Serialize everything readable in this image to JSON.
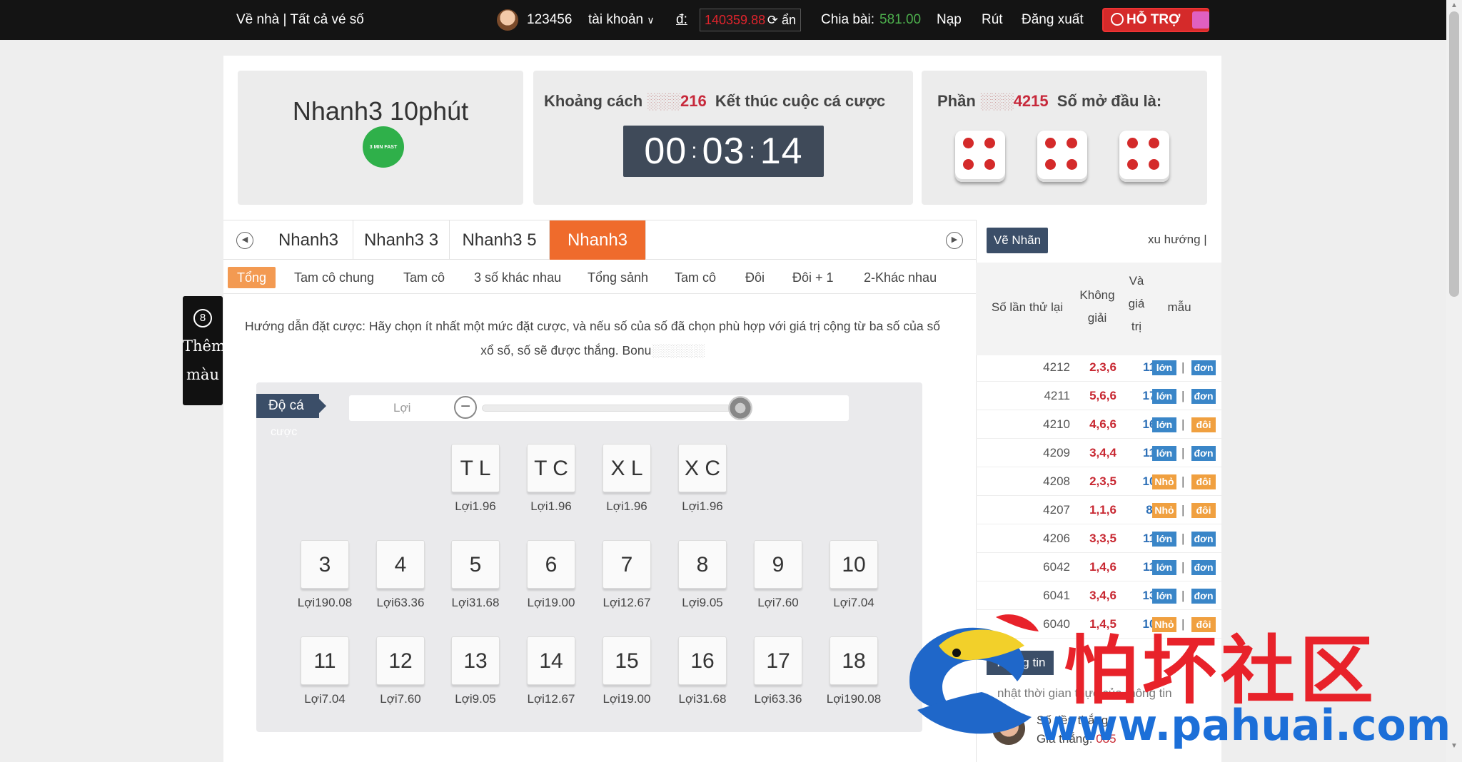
{
  "topbar": {
    "home": "Về nhà | Tất cả vé số",
    "username": "123456",
    "account_menu": "tài khoản",
    "currency_label": "đ:",
    "balance": "140359.88",
    "hide_label": "ẩn",
    "share_label": "Chia bài:",
    "share_value": "581.00",
    "deposit": "Nạp",
    "withdraw": "Rút",
    "logout": "Đăng xuất",
    "support": "HỖ TRỢ"
  },
  "game": {
    "title": "Nhanh3 10phút",
    "logo_text": "3 MIN FAST"
  },
  "countdown": {
    "label_prefix": "Khoảng cách",
    "issue_suffix": "216",
    "label_suffix": "Kết thúc cuộc cá cược",
    "hh": "00",
    "mm": "03",
    "ss": "14"
  },
  "draw": {
    "label_prefix": "Phần",
    "issue_suffix": "4215",
    "label_suffix": "Số mở đầu là:",
    "dice": [
      4,
      4,
      4
    ]
  },
  "tabs": [
    "Nhanh3",
    "Nhanh3 3",
    "Nhanh3 5",
    "Nhanh3"
  ],
  "active_tab": 3,
  "subtabs": [
    "Tổng",
    "Tam cô chung",
    "Tam cô",
    "3 số khác nhau",
    "Tổng sảnh",
    "Tam cô",
    "Đôi",
    "Đôi + 1",
    "2-Khác nhau"
  ],
  "guide": {
    "line1": "Hướng dẫn đặt cược: Hãy chọn ít nhất một mức đặt cược, và nếu số của số đã chọn phù hợp với giá trị cộng từ ba số của số",
    "line2": "xổ số, số sẽ được thắng. Bonu"
  },
  "bet": {
    "button": "Độ cá",
    "button_sub": "cược",
    "slider_label": "Lợi",
    "odds_prefix": "Lợi",
    "specials": [
      {
        "label": "T L",
        "odds": "1.96"
      },
      {
        "label": "T C",
        "odds": "1.96"
      },
      {
        "label": "X L",
        "odds": "1.96"
      },
      {
        "label": "X C",
        "odds": "1.96"
      }
    ],
    "numbers_row1": [
      {
        "label": "3",
        "odds": "190.08"
      },
      {
        "label": "4",
        "odds": "63.36"
      },
      {
        "label": "5",
        "odds": "31.68"
      },
      {
        "label": "6",
        "odds": "19.00"
      },
      {
        "label": "7",
        "odds": "12.67"
      },
      {
        "label": "8",
        "odds": "9.05"
      },
      {
        "label": "9",
        "odds": "7.60"
      },
      {
        "label": "10",
        "odds": "7.04"
      }
    ],
    "numbers_row2": [
      {
        "label": "11",
        "odds": "7.04"
      },
      {
        "label": "12",
        "odds": "7.60"
      },
      {
        "label": "13",
        "odds": "9.05"
      },
      {
        "label": "14",
        "odds": "12.67"
      },
      {
        "label": "15",
        "odds": "19.00"
      },
      {
        "label": "16",
        "odds": "31.68"
      },
      {
        "label": "17",
        "odds": "63.36"
      },
      {
        "label": "18",
        "odds": "190.08"
      }
    ]
  },
  "sidebar": {
    "draw_button": "Vẽ Nhãn",
    "trend_link": "xu hướng |",
    "headers": {
      "issue": "Số lần thử lại",
      "prize": "Không giải",
      "value": "Và giá trị",
      "pattern": "mẫu"
    },
    "history": [
      {
        "issue": "4212",
        "result": "2,3,6",
        "sum": "11",
        "size": "lớn",
        "parity": "đơn"
      },
      {
        "issue": "4211",
        "result": "5,6,6",
        "sum": "17",
        "size": "lớn",
        "parity": "đơn"
      },
      {
        "issue": "4210",
        "result": "4,6,6",
        "sum": "16",
        "size": "lớn",
        "parity": "đôi"
      },
      {
        "issue": "4209",
        "result": "3,4,4",
        "sum": "11",
        "size": "lớn",
        "parity": "đơn"
      },
      {
        "issue": "4208",
        "result": "2,3,5",
        "sum": "10",
        "size": "Nhỏ",
        "parity": "đôi"
      },
      {
        "issue": "4207",
        "result": "1,1,6",
        "sum": "8",
        "size": "Nhỏ",
        "parity": "đôi"
      },
      {
        "issue": "4206",
        "result": "3,3,5",
        "sum": "11",
        "size": "lớn",
        "parity": "đơn"
      },
      {
        "issue": "6042",
        "result": "1,4,6",
        "sum": "11",
        "size": "lớn",
        "parity": "đơn"
      },
      {
        "issue": "6041",
        "result": "3,4,6",
        "sum": "13",
        "size": "lớn",
        "parity": "đơn"
      },
      {
        "issue": "6040",
        "result": "1,4,5",
        "sum": "10",
        "size": "Nhỏ",
        "parity": "đôi"
      }
    ],
    "info_button": "Thông tin",
    "update_text": "nhật thời gian thực của thông tin",
    "user_line1": "Số tiền thắng",
    "user_line2_label": "Giá thắng:",
    "user_line2_value": "085"
  },
  "float_widget": {
    "label_1": "Thêm",
    "label_2": "màu",
    "badge": "8"
  },
  "watermark": {
    "chinese": "怕坏社区",
    "url": "www.pahuai.com"
  },
  "colors": {
    "accent": "#ef6b2c",
    "navy": "#3b4e68",
    "result_red": "#c82832",
    "big_blue": "#3a86c8",
    "small_orange": "#f0a040"
  }
}
